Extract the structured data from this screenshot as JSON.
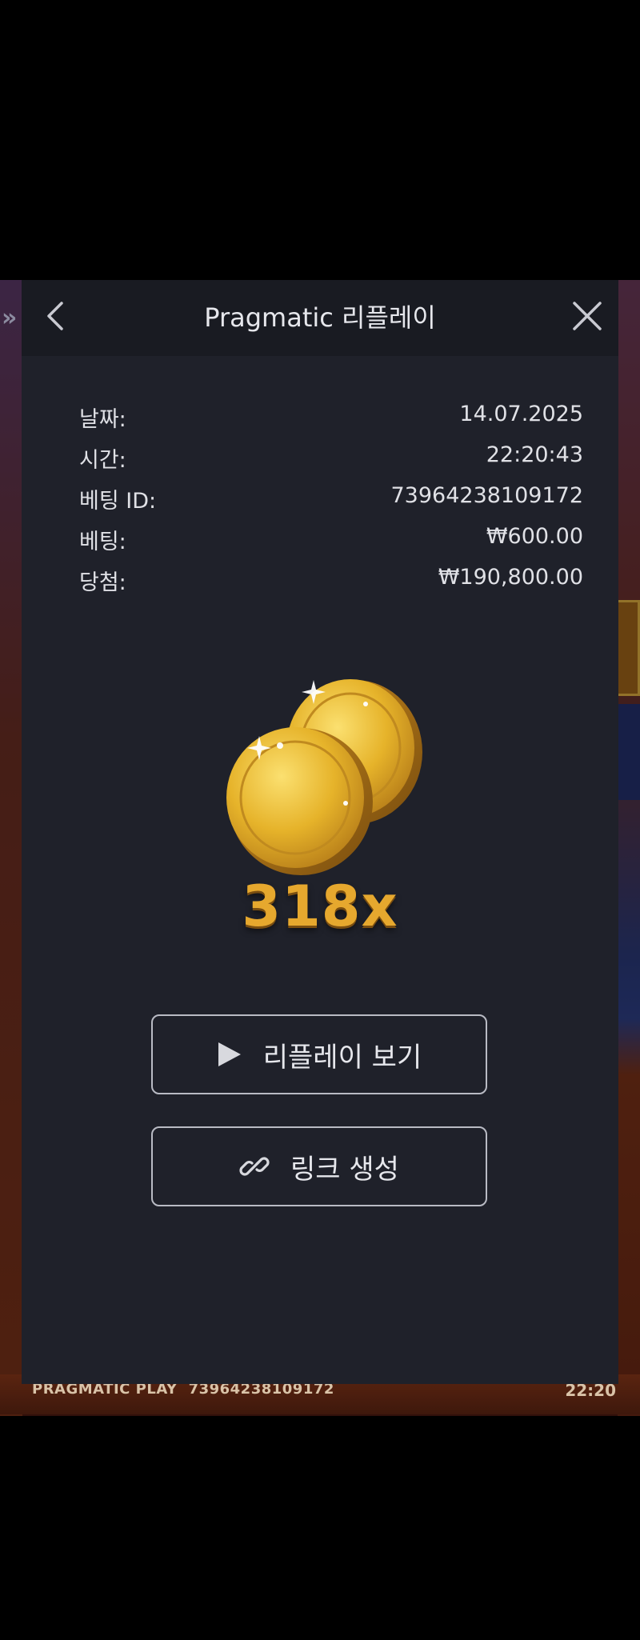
{
  "modal": {
    "title": "Pragmatic 리플레이",
    "icons": {
      "back": "chevron-left-icon",
      "close": "close-icon"
    },
    "details": [
      {
        "label": "날짜:",
        "value": "14.07.2025"
      },
      {
        "label": "시간:",
        "value": "22:20:43"
      },
      {
        "label": "베팅 ID:",
        "value": "73964238109172"
      },
      {
        "label": "베팅:",
        "value": "₩600.00"
      },
      {
        "label": "당첨:",
        "value": "₩190,800.00"
      }
    ],
    "multiplier": "318x",
    "buttons": {
      "replay": {
        "label": "리플레이 보기",
        "icon": "play-icon"
      },
      "link": {
        "label": "링크 생성",
        "icon": "link-icon"
      }
    }
  },
  "background_game": {
    "provider": "PRAGMATIC PLAY",
    "bet_id": "73964238109172",
    "time": "22:20"
  },
  "colors": {
    "modal_bg": "#1f212a",
    "header_bg": "#191b22",
    "text": "#e0e1e6",
    "multiplier_gold": "#e6a82e",
    "button_border": "#b9bbc4"
  }
}
